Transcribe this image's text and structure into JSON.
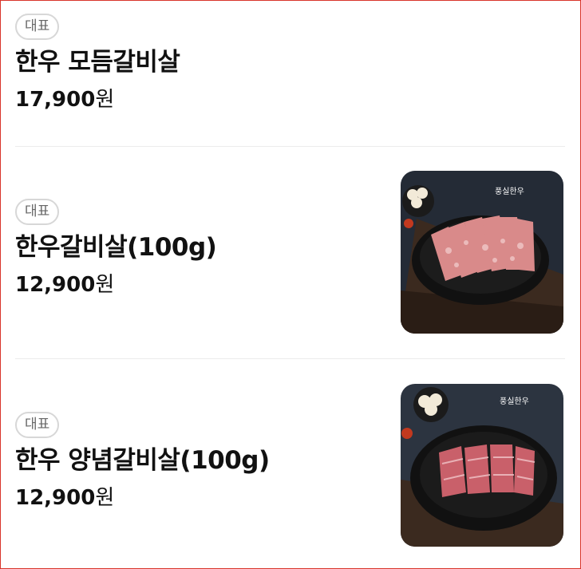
{
  "menu": {
    "items": [
      {
        "badge": "대표",
        "name": "한우 모듬갈비살",
        "price": "17,900",
        "currency": "원",
        "image": null
      },
      {
        "badge": "대표",
        "name": "한우갈비살(100g)",
        "price": "12,900",
        "currency": "원",
        "image": {
          "brand": "풍실한우",
          "icon": "cow-logo-icon"
        }
      },
      {
        "badge": "대표",
        "name": "한우 양념갈비살(100g)",
        "price": "12,900",
        "currency": "원",
        "image": {
          "brand": "풍실한우",
          "icon": "cow-logo-icon"
        }
      }
    ]
  },
  "colors": {
    "badge_border": "#d7d7d7",
    "badge_text": "#666666",
    "divider": "#ececec",
    "frame_border": "#d9342b"
  }
}
